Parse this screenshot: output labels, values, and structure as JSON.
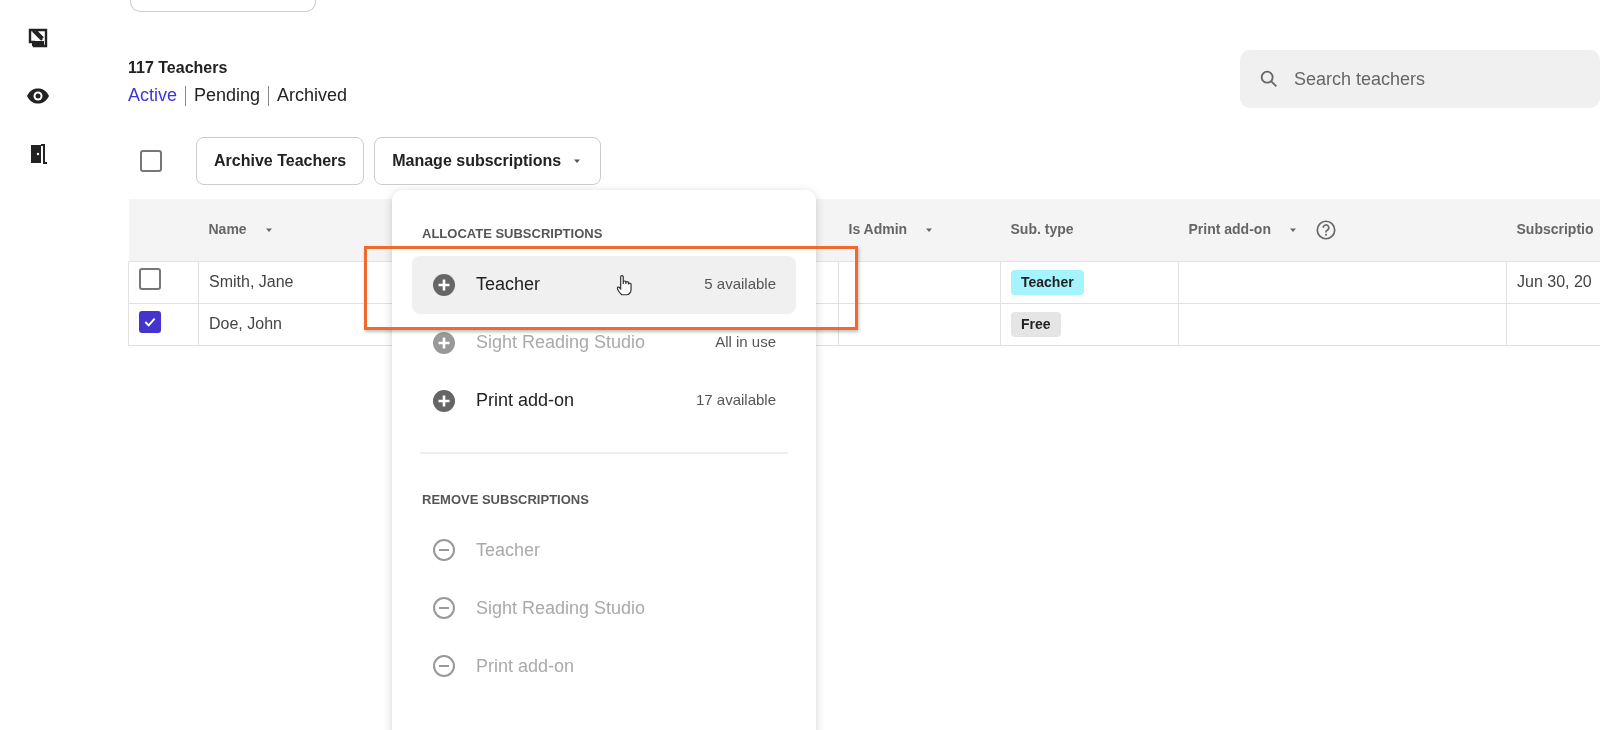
{
  "sidebar": {
    "items": [
      {
        "kind": "whiteboard"
      },
      {
        "kind": "eye"
      },
      {
        "kind": "door"
      }
    ]
  },
  "heading": "117 Teachers",
  "tabs": [
    {
      "label": "Active",
      "selected": true
    },
    {
      "label": "Pending",
      "selected": false
    },
    {
      "label": "Archived",
      "selected": false
    }
  ],
  "search": {
    "placeholder": "Search teachers"
  },
  "toolbar": {
    "select_all_checked": false,
    "buttons": [
      {
        "label": "Archive Teachers",
        "dropdown": false
      },
      {
        "label": "Manage subscriptions",
        "dropdown": true
      }
    ]
  },
  "table": {
    "columns": [
      {
        "label": "Name",
        "kind": "sortable"
      },
      {
        "label": "Is Admin",
        "kind": "sortable"
      },
      {
        "label": "Sub. type",
        "kind": "plain"
      },
      {
        "label": "Print add-on",
        "kind": "sortable_help"
      },
      {
        "label": "Subscriptio",
        "kind": "plain"
      }
    ],
    "rows": [
      {
        "checked": false,
        "name": "Smith, Jane",
        "sub_type": {
          "label": "Teacher",
          "color": "#a5f3fc"
        },
        "subscription": "Jun 30, 20"
      },
      {
        "checked": true,
        "name": "Doe, John",
        "sub_type": {
          "label": "Free",
          "color": "#e5e5e5"
        }
      }
    ]
  },
  "menu": {
    "sections": [
      {
        "title": "ALLOCATE SUBSCRIPTIONS",
        "kind": "add",
        "items": [
          {
            "label": "Teacher",
            "note": "5 available",
            "disabled": false,
            "highlighted": true
          },
          {
            "label": "Sight Reading Studio",
            "note": "All in use",
            "disabled": true,
            "highlighted": false
          },
          {
            "label": "Print add-on",
            "note": "17 available",
            "disabled": false,
            "highlighted": false
          }
        ]
      },
      {
        "title": "REMOVE SUBSCRIPTIONS",
        "kind": "remove",
        "items": [
          {
            "label": "Teacher",
            "disabled": true,
            "highlighted": false
          },
          {
            "label": "Sight Reading Studio",
            "disabled": true,
            "highlighted": false
          },
          {
            "label": "Print add-on",
            "disabled": true,
            "highlighted": false
          }
        ]
      }
    ]
  }
}
